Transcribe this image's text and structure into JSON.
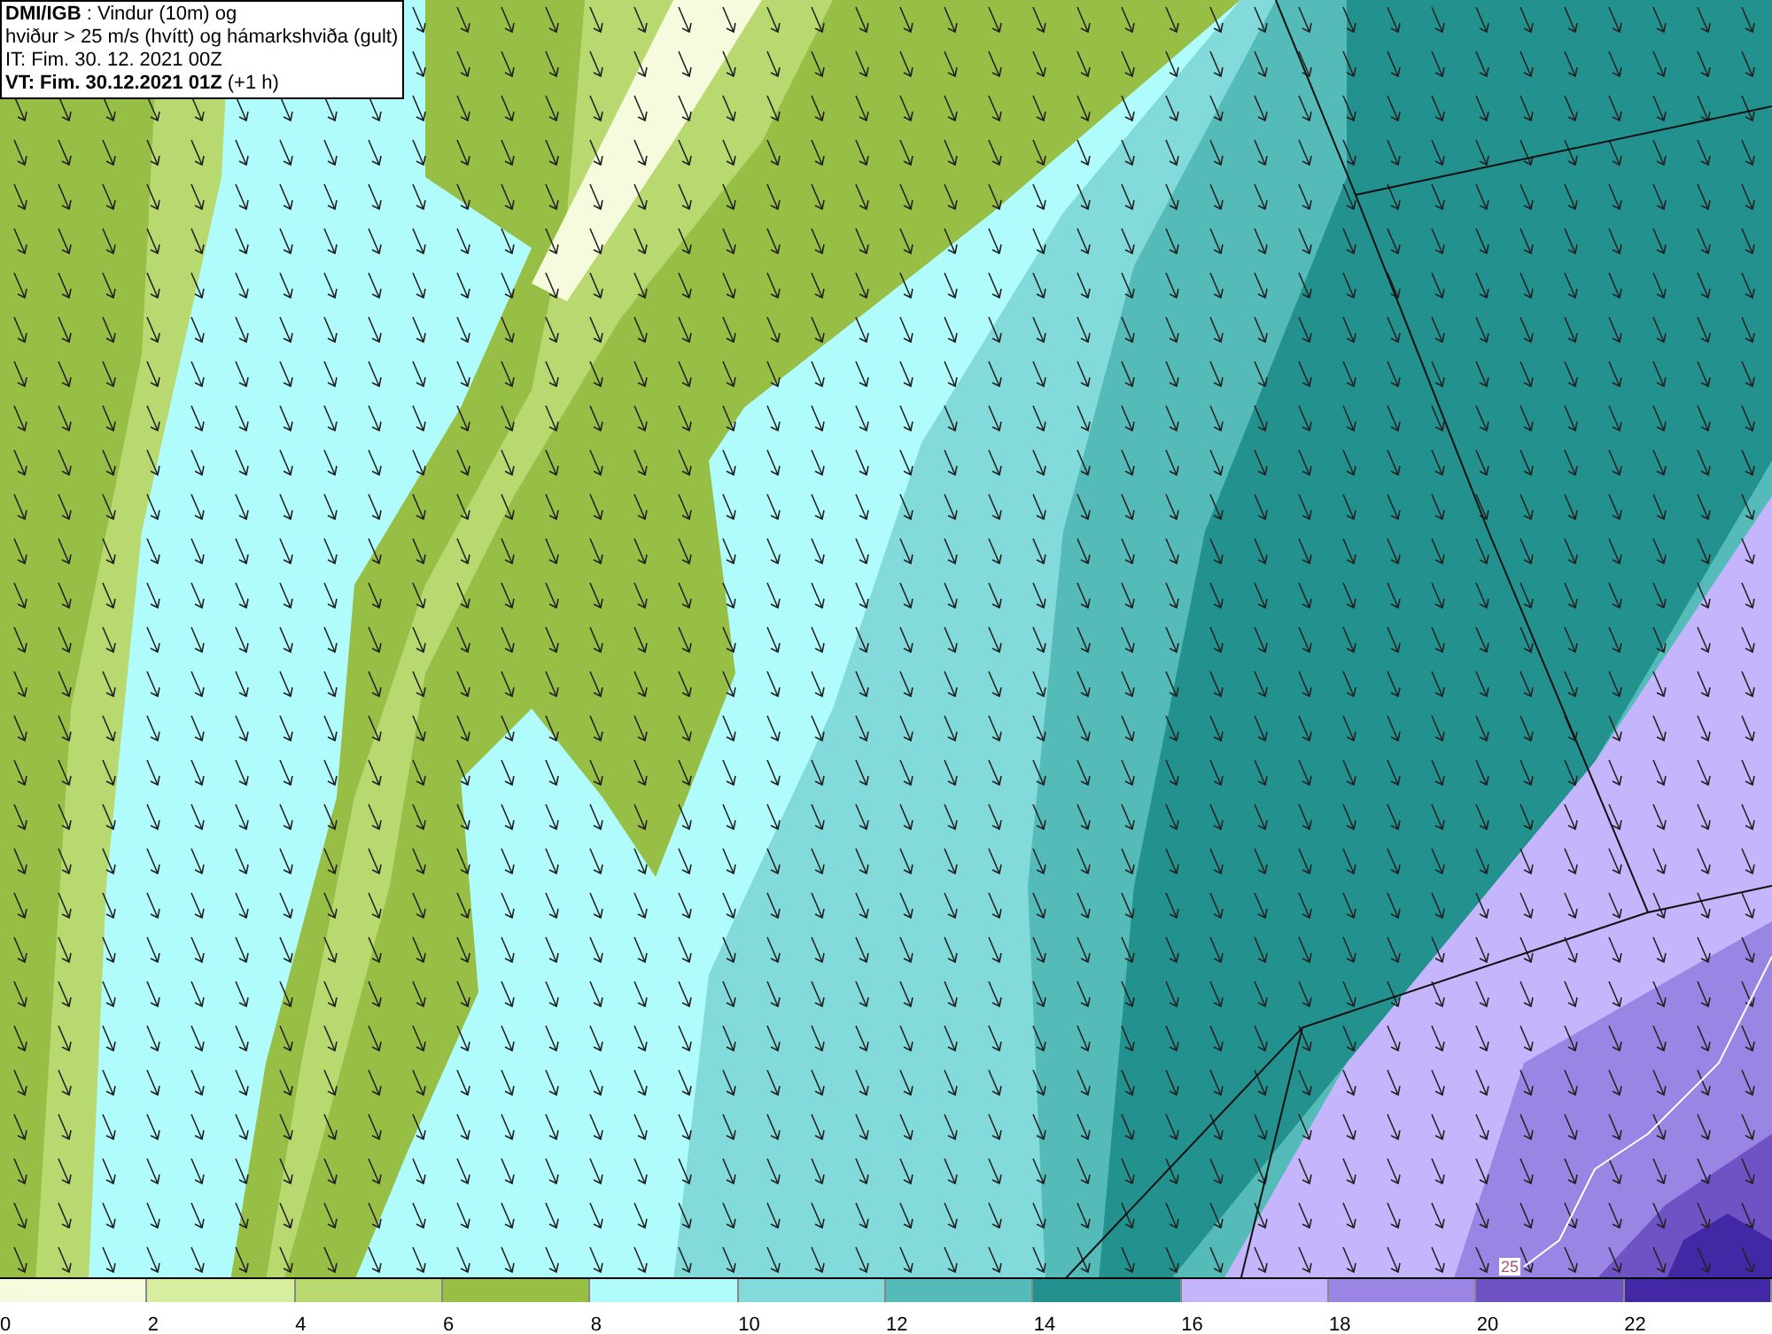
{
  "header": {
    "lines": [
      "**DMI/IGB** : Vindur (10m) og",
      "hviður > 25 m/s (hvítt) og hámarkshviða (gult)",
      "IT: Fim. 30. 12. 2021 00Z",
      "**VT: Fim. 30.12.2021 01Z** (+1 h)"
    ]
  },
  "map": {
    "contour_label": "25"
  },
  "legend": [
    {
      "label": "0",
      "color": "#f5fbdc"
    },
    {
      "label": "2",
      "color": "#d6ee9d"
    },
    {
      "label": "4",
      "color": "#b7d96f"
    },
    {
      "label": "6",
      "color": "#97be45"
    },
    {
      "label": "8",
      "color": "#b0fcfc"
    },
    {
      "label": "10",
      "color": "#82dada"
    },
    {
      "label": "12",
      "color": "#55bbb8"
    },
    {
      "label": "14",
      "color": "#23918d"
    },
    {
      "label": "16",
      "color": "#c4b5fc"
    },
    {
      "label": "18",
      "color": "#9a85e4"
    },
    {
      "label": "20",
      "color": "#6f52c4"
    },
    {
      "label": "22",
      "color": "#4328a6"
    }
  ]
}
